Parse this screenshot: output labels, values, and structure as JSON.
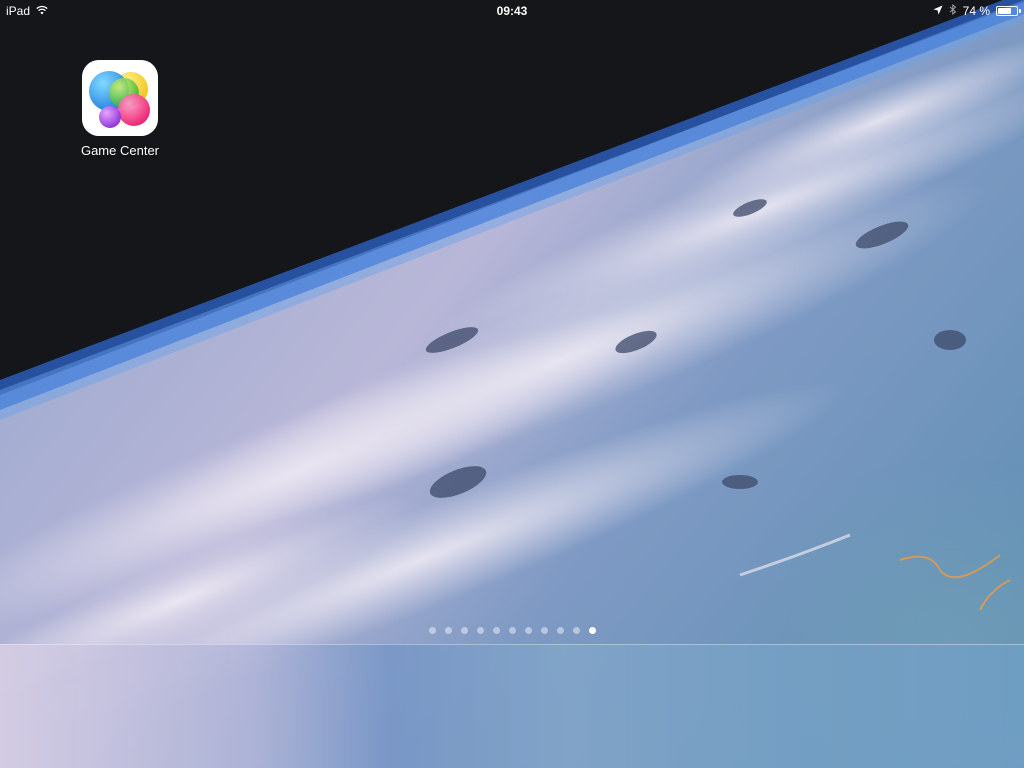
{
  "status_bar": {
    "device": "iPad",
    "time": "09:43",
    "battery_percent_text": "74 %",
    "battery_level": 0.74,
    "icons": [
      "wifi-icon",
      "location-arrow-icon",
      "bluetooth-icon",
      "battery-icon"
    ]
  },
  "home_screen": {
    "apps": [
      {
        "label": "Game Center",
        "icon": "game-center-icon"
      }
    ],
    "page_indicator": {
      "count": 11,
      "active_index": 10
    }
  },
  "dock": {
    "apps": []
  },
  "colors": {
    "text": "#ffffff",
    "space": "#151619",
    "dock_tint": "#7a9cc6"
  }
}
